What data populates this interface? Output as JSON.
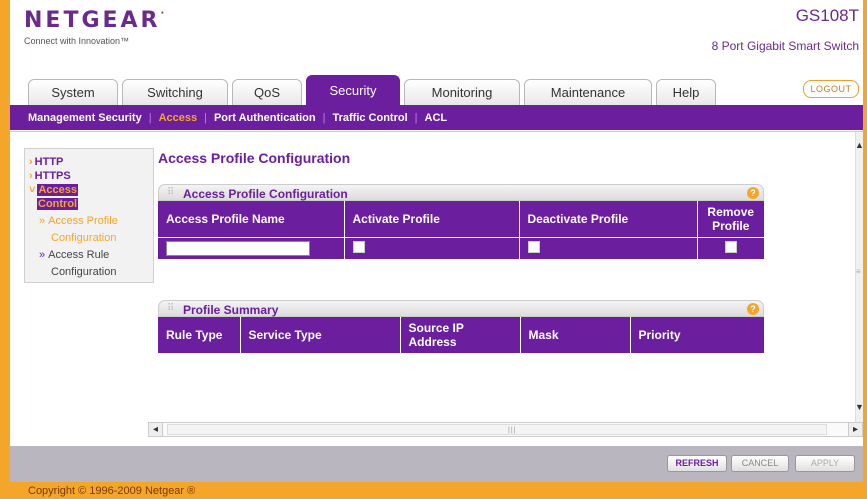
{
  "header": {
    "logo": "NETGEAR",
    "tagline": "Connect with Innovation™",
    "model": "GS108T",
    "model_desc": "8 Port Gigabit Smart Switch"
  },
  "tabs": [
    {
      "label": "System",
      "active": false
    },
    {
      "label": "Switching",
      "active": false
    },
    {
      "label": "QoS",
      "active": false
    },
    {
      "label": "Security",
      "active": true
    },
    {
      "label": "Monitoring",
      "active": false
    },
    {
      "label": "Maintenance",
      "active": false
    },
    {
      "label": "Help",
      "active": false
    }
  ],
  "logout_label": "LOGOUT",
  "submenu": [
    {
      "label": "Management Security",
      "active": false
    },
    {
      "label": "Access",
      "active": true
    },
    {
      "label": "Port Authentication",
      "active": false
    },
    {
      "label": "Traffic Control",
      "active": false
    },
    {
      "label": "ACL",
      "active": false
    }
  ],
  "leftnav": {
    "http": "HTTP",
    "https": "HTTPS",
    "access_control_1": "Access",
    "access_control_2": "Control",
    "access_profile_1": "Access Profile",
    "access_profile_2": "Configuration",
    "access_rule_1": "Access Rule",
    "access_rule_2": "Configuration"
  },
  "page_title": "Access Profile Configuration",
  "profile_panel": {
    "title": "Access Profile Configuration",
    "columns": [
      "Access Profile Name",
      "Activate Profile",
      "Deactivate Profile",
      "Remove Profile"
    ],
    "profile_name_value": ""
  },
  "summary_panel": {
    "title": "Profile Summary",
    "columns": [
      "Rule Type",
      "Service Type",
      "Source IP Address",
      "Mask",
      "Priority"
    ]
  },
  "buttons": {
    "refresh": "REFRESH",
    "cancel": "CANCEL",
    "apply": "APPLY"
  },
  "footer": {
    "copyright": "Copyright © 1996-2009 Netgear ®"
  },
  "colors": {
    "brand_purple": "#6b1e9e",
    "brand_orange": "#f4a62a"
  }
}
